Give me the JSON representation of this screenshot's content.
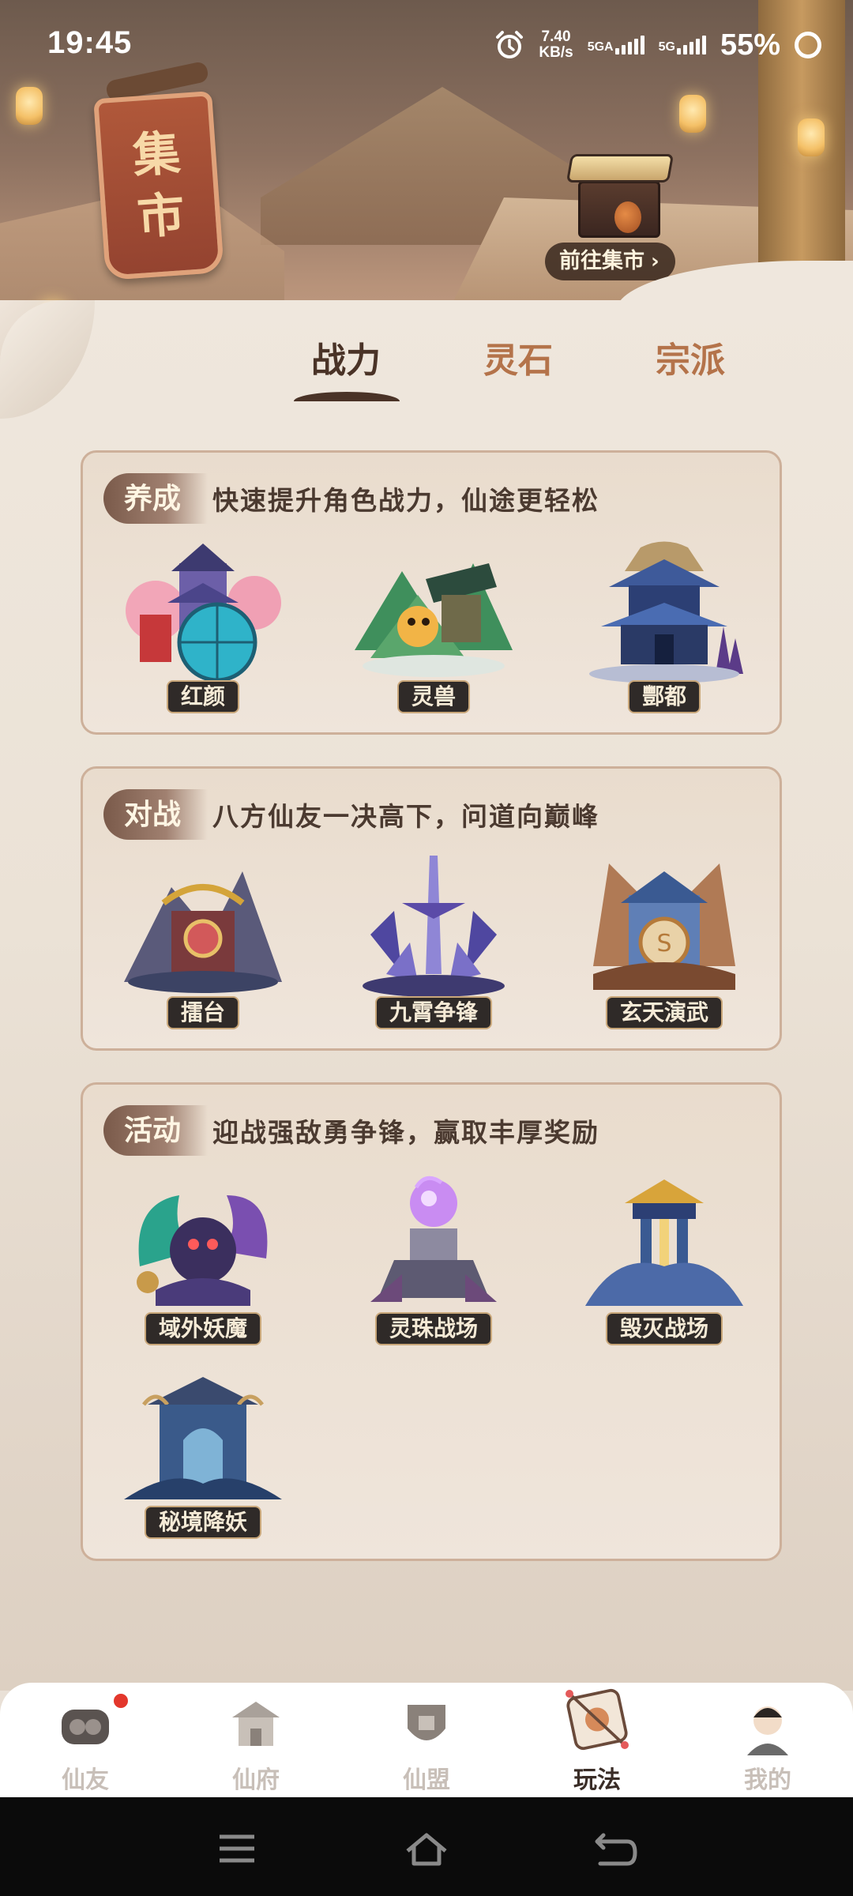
{
  "status_bar": {
    "time": "19:45",
    "speed_value": "7.40",
    "speed_unit": "KB/s",
    "net1": "5GA",
    "net2": "5G",
    "battery": "55%"
  },
  "header": {
    "banner_char_1": "集",
    "banner_char_2": "市",
    "goto_market": "前往集市"
  },
  "tabs": [
    {
      "label": "战力",
      "active": true
    },
    {
      "label": "灵石",
      "active": false
    },
    {
      "label": "宗派",
      "active": false
    }
  ],
  "sections": [
    {
      "title": "养成",
      "desc": "快速提升角色战力，仙途更轻松",
      "items": [
        {
          "label": "红颜",
          "icon": "beauty-pavilion-icon"
        },
        {
          "label": "灵兽",
          "icon": "spirit-beast-icon"
        },
        {
          "label": "酆都",
          "icon": "fengdu-palace-icon"
        }
      ]
    },
    {
      "title": "对战",
      "desc": "八方仙友一决高下，问道向巅峰",
      "items": [
        {
          "label": "擂台",
          "icon": "arena-icon"
        },
        {
          "label": "九霄争锋",
          "icon": "sword-peak-icon"
        },
        {
          "label": "玄天演武",
          "icon": "martial-temple-icon"
        }
      ]
    },
    {
      "title": "活动",
      "desc": "迎战强敌勇争锋，赢取丰厚奖励",
      "items": [
        {
          "label": "域外妖魔",
          "icon": "dragon-demon-icon"
        },
        {
          "label": "灵珠战场",
          "icon": "spirit-orb-altar-icon"
        },
        {
          "label": "毁灭战场",
          "icon": "destruction-gate-icon"
        },
        {
          "label": "秘境降妖",
          "icon": "secret-realm-gate-icon"
        }
      ]
    }
  ],
  "bottom_nav": [
    {
      "label": "仙友",
      "icon": "friends-icon",
      "active": false,
      "badge": true
    },
    {
      "label": "仙府",
      "icon": "mansion-icon",
      "active": false,
      "badge": false
    },
    {
      "label": "仙盟",
      "icon": "alliance-icon",
      "active": false,
      "badge": false
    },
    {
      "label": "玩法",
      "icon": "gameplay-icon",
      "active": true,
      "badge": false
    },
    {
      "label": "我的",
      "icon": "profile-icon",
      "active": false,
      "badge": false
    }
  ],
  "colors": {
    "accent_dark": "#4a3327",
    "tab_inactive": "#b4734a",
    "label_bg": "#2f2a28",
    "badge_red": "#e3372c"
  }
}
